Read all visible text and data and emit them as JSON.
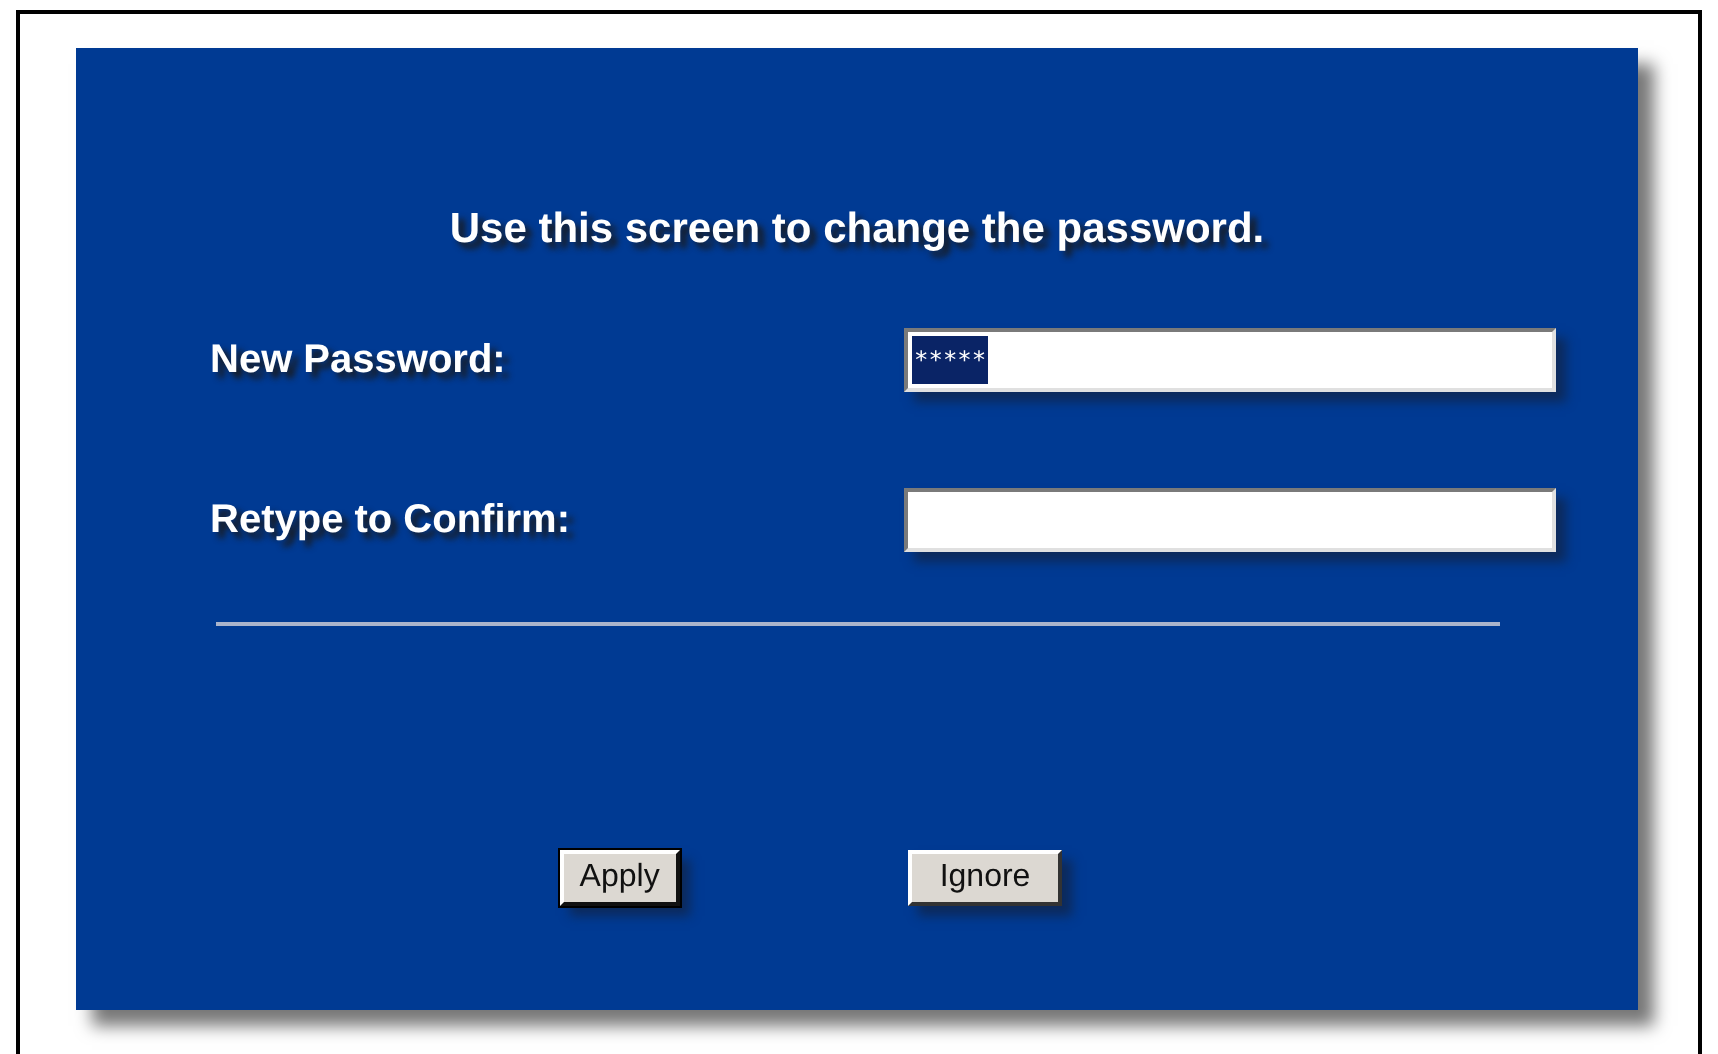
{
  "heading": "Use this screen to change the password.",
  "fields": [
    {
      "label": "New Password:",
      "value": "*****",
      "highlighted": true
    },
    {
      "label": "Retype to Confirm:"
    }
  ],
  "buttons": [
    {
      "label": "Apply",
      "focused": true
    },
    {
      "label": "Ignore",
      "focused": false
    }
  ]
}
